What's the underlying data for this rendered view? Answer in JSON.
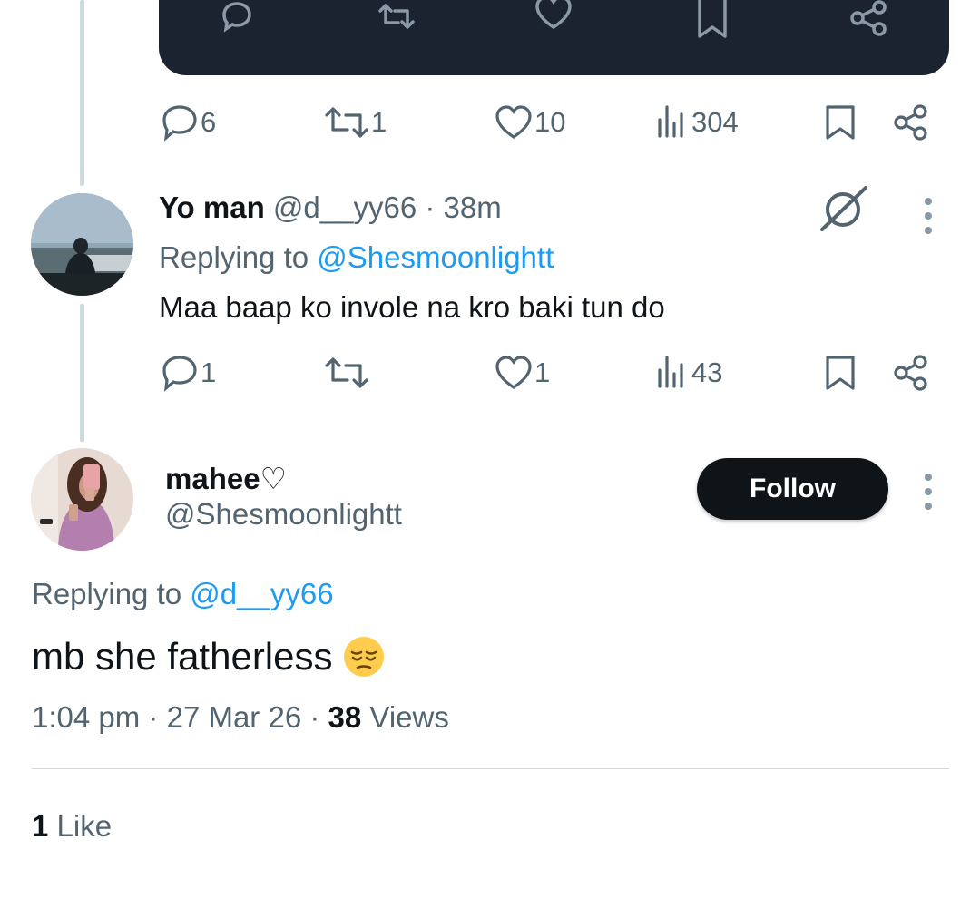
{
  "colors": {
    "accent": "#1d9bf0",
    "text": "#0f1419",
    "muted": "#536471",
    "thread_line": "#cfd9de",
    "media_bg": "#1b2330",
    "follow_bg": "#0f1419"
  },
  "media_card": {
    "icons": [
      "reply-icon",
      "retweet-icon",
      "like-icon",
      "bookmark-icon",
      "share-icon"
    ]
  },
  "parent_actions": {
    "replies": "6",
    "retweets": "1",
    "likes": "10",
    "views": "304"
  },
  "reply_tweet": {
    "name": "Yo man",
    "handle": "@d__yy66",
    "time": "38m",
    "replying_label": "Replying to",
    "replying_to": "@Shesmoonlightt",
    "text": "Maa baap ko invole na kro baki tun do",
    "actions": {
      "replies": "1",
      "retweets": "",
      "likes": "1",
      "views": "43"
    }
  },
  "main_tweet": {
    "name": "mahee♡",
    "handle": "@Shesmoonlightt",
    "follow_label": "Follow",
    "replying_label": "Replying to",
    "replying_to": "@d__yy66",
    "text": "mb she fatherless",
    "emoji": "pensive-face-emoji",
    "time": "1:04 pm",
    "date": "27 Mar 26",
    "views_count": "38",
    "views_label": "Views",
    "likes_count": "1",
    "likes_label": "Like"
  }
}
